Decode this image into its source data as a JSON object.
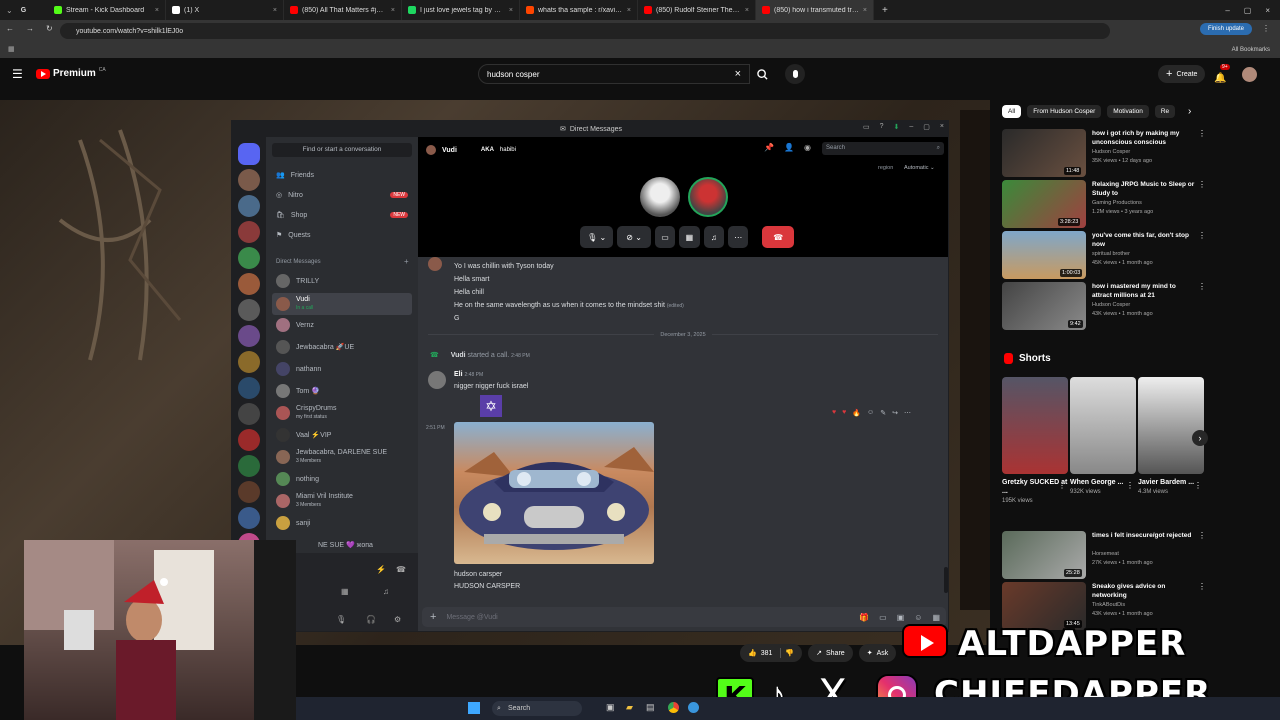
{
  "browser": {
    "tabs": [
      {
        "label": "Stream - Kick Dashboard",
        "color": "#53fc18"
      },
      {
        "label": "(1) X",
        "color": "#ffffff"
      },
      {
        "label": "(850) All That Matters #jerseyclu",
        "color": "#ff0000"
      },
      {
        "label": "I just love jewels tag by money",
        "color": "#1ed760"
      },
      {
        "label": "whats tha sample : r/xaviersobas",
        "color": "#ff4500"
      },
      {
        "label": "(850) Rudolf Steiner The Spiritu",
        "color": "#ff0000"
      },
      {
        "label": "(850) how i transmuted trauma",
        "color": "#ff0000"
      }
    ],
    "url": "youtube.com/watch?v=shilk1lEJ0o",
    "finish_update": "Finish update",
    "all_bookmarks": "All Bookmarks"
  },
  "youtube": {
    "logo_text": "Premium",
    "region": "CA",
    "search_value": "hudson cosper",
    "create_label": "Create",
    "notif_count": "9+",
    "chips": [
      "All",
      "From Hudson Cosper",
      "Motivation",
      "Re"
    ],
    "recommendations": [
      {
        "title": "how i got rich by making my unconscious conscious",
        "channel": "Hudson Cosper",
        "meta": "35K views • 12 days ago",
        "duration": "11:48"
      },
      {
        "title": "Relaxing JRPG Music to Sleep or Study to",
        "channel": "Gaming Productions",
        "meta": "1.2M views • 3 years ago",
        "duration": "3:28:23"
      },
      {
        "title": "you've come this far, don't stop now",
        "channel": "spiritual brother",
        "meta": "45K views • 1 month ago",
        "duration": "1:00:03"
      },
      {
        "title": "how i mastered my mind to attract millions at 21",
        "channel": "Hudson Cosper",
        "meta": "43K views • 1 month ago",
        "duration": "9:42"
      }
    ],
    "shorts_label": "Shorts",
    "shorts": [
      {
        "title": "Gretzky SUCKED at ...",
        "views": "195K views"
      },
      {
        "title": "When George ...",
        "views": "932K views"
      },
      {
        "title": "Javier Bardem ...",
        "views": "4.3M views"
      }
    ],
    "more_recs": [
      {
        "title": "times i felt insecure/got rejected",
        "channel": "Horsemeat",
        "meta": "27K views • 1 month ago",
        "duration": "25:28"
      },
      {
        "title": "Sneako gives advice on networking",
        "channel": "TinkABoutDis",
        "meta": "43K views • 1 month ago",
        "duration": "13:45"
      }
    ],
    "likes": "381",
    "share_label": "Share",
    "ask_label": "Ask"
  },
  "discord": {
    "window_title": "Direct Messages",
    "find_placeholder": "Find or start a conversation",
    "nav": [
      "Friends",
      "Nitro",
      "Shop",
      "Quests"
    ],
    "new_badge": "NEW",
    "dm_header": "Direct Messages",
    "dms": [
      {
        "name": "TRILLY",
        "sub": ""
      },
      {
        "name": "Vudi",
        "sub": "In a call"
      },
      {
        "name": "Vernz",
        "sub": ""
      },
      {
        "name": "Jewbacabra 🚀UE",
        "sub": ""
      },
      {
        "name": "nathann",
        "sub": ""
      },
      {
        "name": "Tom 🔮",
        "sub": ""
      },
      {
        "name": "CrispyDrums",
        "sub": "my first status"
      },
      {
        "name": "Vaal ⚡VIP",
        "sub": ""
      },
      {
        "name": "Jewbacabra, DARLENE SUE",
        "sub": "3 Members"
      },
      {
        "name": "nothing",
        "sub": ""
      },
      {
        "name": "Miami Vril Institute",
        "sub": "3 Members"
      },
      {
        "name": "sanji",
        "sub": ""
      }
    ],
    "partial_dm": "NE SUE 💜 жопа",
    "call_user": "Vudi",
    "aka_label": "AKA",
    "aka_value": "habibi",
    "search_placeholder": "Search",
    "region_label": "region",
    "region_value": "Automatic",
    "messages": [
      {
        "text": "Yo I was chillin with Tyson today"
      },
      {
        "text": "Hella smart"
      },
      {
        "text": "Hella chill"
      },
      {
        "text": "He on the same wavelength as us when it comes to the mindset shit",
        "edited": "(edited)"
      },
      {
        "text": "G"
      }
    ],
    "date_divider": "December 3, 2025",
    "call_event_user": "Vudi",
    "call_event_text": "started a call.",
    "call_event_time": "2:48 PM",
    "eli_name": "Eli",
    "eli_time": "2:48 PM",
    "eli_text": "nigger nigger fuck israel",
    "image_time": "2:51 PM",
    "caption1": "hudson carsper",
    "caption2": "HUDSON CARSPER",
    "compose_placeholder": "Message @Vudi"
  },
  "overlay": {
    "line1": "ALTDAPPER",
    "line2": "CHIEFDAPPER"
  },
  "taskbar": {
    "search_label": "Search"
  }
}
